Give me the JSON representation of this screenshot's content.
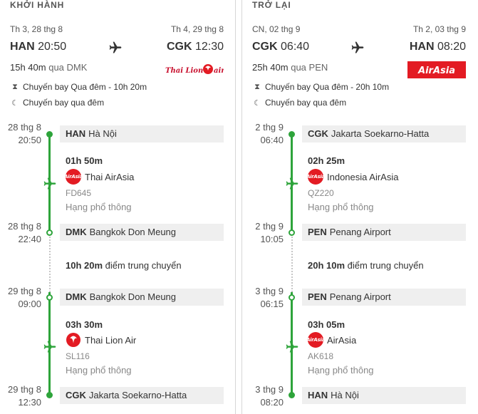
{
  "outbound": {
    "section_title": "KHỞI HÀNH",
    "dep_date": "Th 3, 28 thg 8",
    "arr_date": "Th 4, 29 thg 8",
    "dep_code": "HAN",
    "dep_time": "20:50",
    "arr_code": "CGK",
    "arr_time": "12:30",
    "duration": "15h 40m",
    "via": "qua DMK",
    "brand_logo_text": "Thai Lion air",
    "notes": [
      "Chuyến bay Qua đêm - 10h 20m",
      "Chuyến bay qua đêm"
    ],
    "stops": [
      {
        "date": "28 thg 8",
        "time": "20:50",
        "code": "HAN",
        "name": "Hà Nội"
      },
      {
        "date": "28 thg 8",
        "time": "22:40",
        "code": "DMK",
        "name": "Bangkok Don Meung"
      },
      {
        "date": "29 thg 8",
        "time": "09:00",
        "code": "DMK",
        "name": "Bangkok Don Meung"
      },
      {
        "date": "29 thg 8",
        "time": "12:30",
        "code": "CGK",
        "name": "Jakarta Soekarno-Hatta"
      }
    ],
    "segments": [
      {
        "duration": "01h 50m",
        "airline": "Thai AirAsia",
        "flight_no": "FD645",
        "cabin": "Hạng phổ thông",
        "logo": "airasia"
      },
      {
        "duration": "03h 30m",
        "airline": "Thai Lion Air",
        "flight_no": "SL116",
        "cabin": "Hạng phổ thông",
        "logo": "lion"
      }
    ],
    "layover": {
      "duration": "10h 20m",
      "label": "điểm trung chuyển"
    }
  },
  "return": {
    "section_title": "TRỞ LẠI",
    "dep_date": "CN, 02 thg 9",
    "arr_date": "Th 2, 03 thg 9",
    "dep_code": "CGK",
    "dep_time": "06:40",
    "arr_code": "HAN",
    "arr_time": "08:20",
    "duration": "25h 40m",
    "via": "qua PEN",
    "brand_logo_text": "AirAsia",
    "notes": [
      "Chuyến bay Qua đêm - 20h 10m",
      "Chuyến bay qua đêm"
    ],
    "stops": [
      {
        "date": "2 thg 9",
        "time": "06:40",
        "code": "CGK",
        "name": "Jakarta Soekarno-Hatta"
      },
      {
        "date": "2 thg 9",
        "time": "10:05",
        "code": "PEN",
        "name": "Penang Airport"
      },
      {
        "date": "3 thg 9",
        "time": "06:15",
        "code": "PEN",
        "name": "Penang Airport"
      },
      {
        "date": "3 thg 9",
        "time": "08:20",
        "code": "HAN",
        "name": "Hà Nội"
      }
    ],
    "segments": [
      {
        "duration": "02h 25m",
        "airline": "Indonesia AirAsia",
        "flight_no": "QZ220",
        "cabin": "Hạng phổ thông",
        "logo": "airasia"
      },
      {
        "duration": "03h 05m",
        "airline": "AirAsia",
        "flight_no": "AK618",
        "cabin": "Hạng phổ thông",
        "logo": "airasia"
      }
    ],
    "layover": {
      "duration": "20h 10m",
      "label": "điểm trung chuyển"
    }
  },
  "icons": {
    "plane": "plane-icon",
    "hourglass": "hourglass-icon",
    "moon": "moon-icon"
  },
  "colors": {
    "timeline_green": "#2ea43b",
    "airasia_red": "#e31b23"
  }
}
